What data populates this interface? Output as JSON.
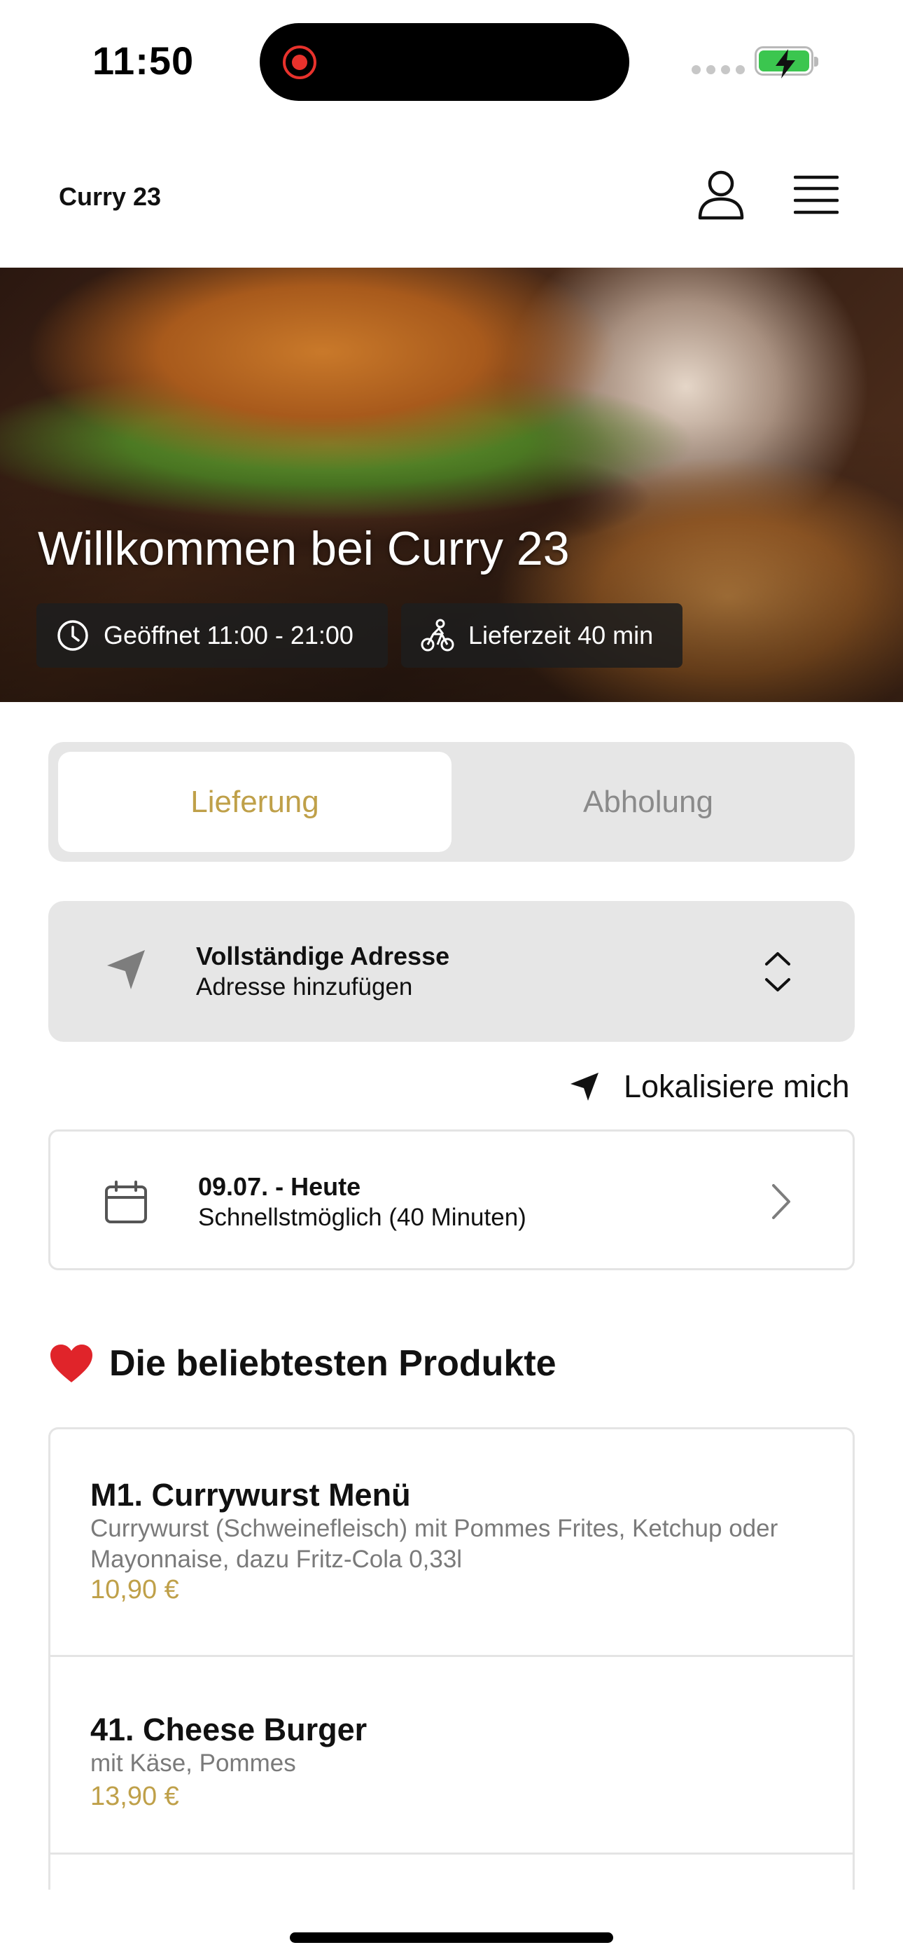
{
  "status_bar": {
    "time": "11:50"
  },
  "header": {
    "brand": "Curry 23"
  },
  "hero": {
    "title": "Willkommen bei Curry 23",
    "open_hours": "Geöffnet 11:00 - 21:00",
    "delivery_time": "Lieferzeit 40 min"
  },
  "mode": {
    "delivery": "Lieferung",
    "pickup": "Abholung",
    "selected": "Lieferung"
  },
  "address": {
    "title": "Vollständige Adresse",
    "subtitle": "Adresse hinzufügen"
  },
  "locate": {
    "label": "Lokalisiere mich"
  },
  "schedule": {
    "date": "09.07. - Heute",
    "time": "Schnellstmöglich (40 Minuten)"
  },
  "popular": {
    "title": "Die beliebtesten Produkte",
    "products": [
      {
        "name": "M1. Currywurst Menü",
        "description": "Currywurst (Schweinefleisch) mit Pommes Frites, Ketchup oder Mayonnaise, dazu Fritz-Cola 0,33l",
        "price": "10,90 €"
      },
      {
        "name": "41. Cheese Burger",
        "description": "mit Käse, Pommes",
        "price": "13,90 €"
      }
    ]
  },
  "colors": {
    "accent": "#bfa049",
    "battery": "#3bc64f",
    "recording": "#e8322c"
  }
}
